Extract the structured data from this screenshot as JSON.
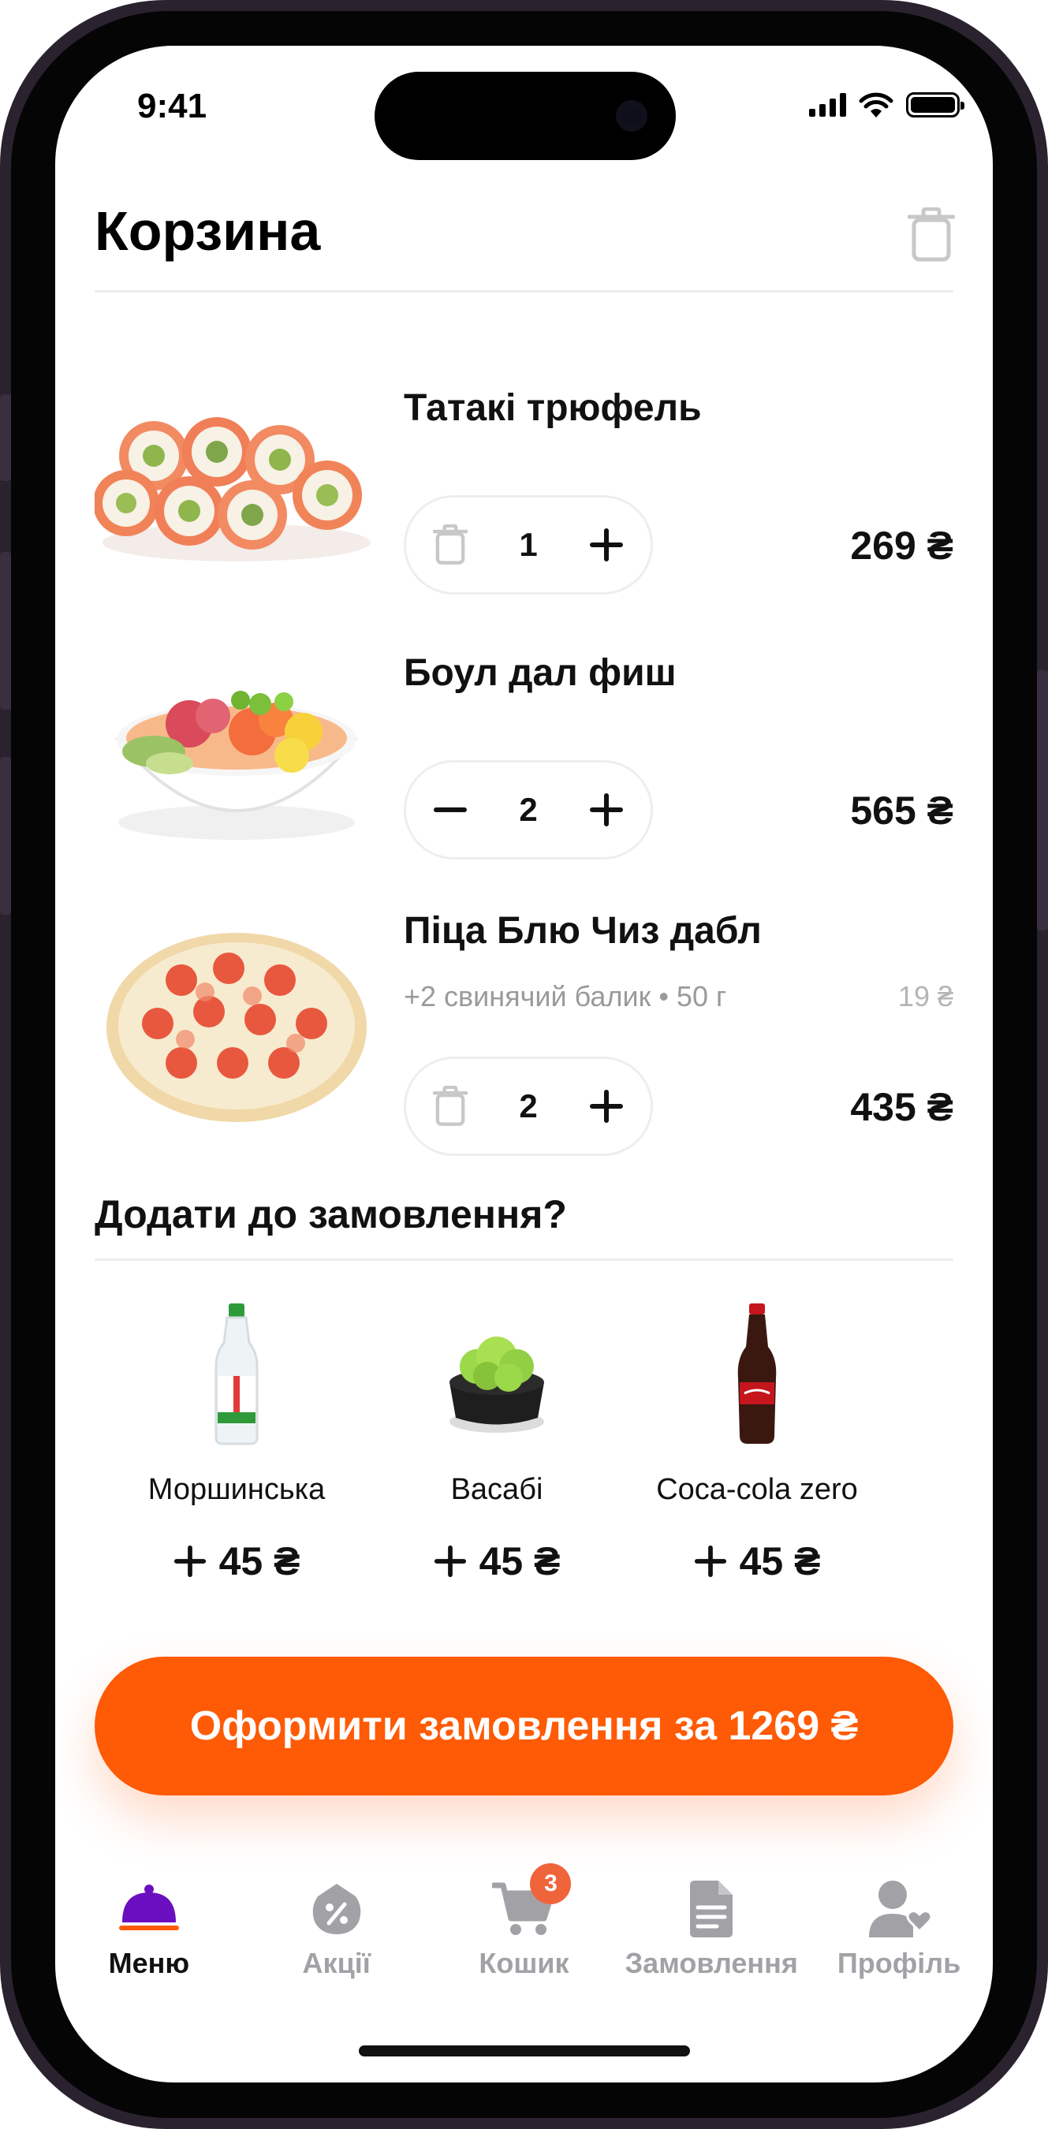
{
  "status_bar": {
    "time": "9:41"
  },
  "header": {
    "title": "Корзина"
  },
  "cart": {
    "items": [
      {
        "name": "Татакі трюфель",
        "qty": "1",
        "price": "269 ₴",
        "modifier": "",
        "modifier_price": ""
      },
      {
        "name": "Боул дал фиш",
        "qty": "2",
        "price": "565 ₴",
        "modifier": "",
        "modifier_price": ""
      },
      {
        "name": "Піца Блю Чиз дабл",
        "qty": "2",
        "price": "435 ₴",
        "modifier": "+2 свинячий балик • 50 г",
        "modifier_price": "19 ₴"
      }
    ]
  },
  "addons": {
    "title": "Додати до замовлення?",
    "items": [
      {
        "name": "Моршинська",
        "price": "45 ₴"
      },
      {
        "name": "Васабі",
        "price": "45 ₴"
      },
      {
        "name": "Coca-cola zero",
        "price": "45 ₴"
      }
    ]
  },
  "checkout": {
    "label": "Оформити замовлення за 1269 ₴"
  },
  "tabbar": {
    "items": [
      {
        "label": "Меню",
        "icon": "cloche-icon",
        "active": true
      },
      {
        "label": "Акції",
        "icon": "discount-icon",
        "active": false
      },
      {
        "label": "Кошик",
        "icon": "cart-icon",
        "active": false,
        "badge": "3"
      },
      {
        "label": "Замовлення",
        "icon": "orders-icon",
        "active": false
      },
      {
        "label": "Профіль",
        "icon": "profile-icon",
        "active": false
      }
    ]
  },
  "colors": {
    "accent": "#FF5A05",
    "badge": "#F0643C",
    "active_tab": "#6A0FC0",
    "inactive": "#A2A2A6"
  }
}
